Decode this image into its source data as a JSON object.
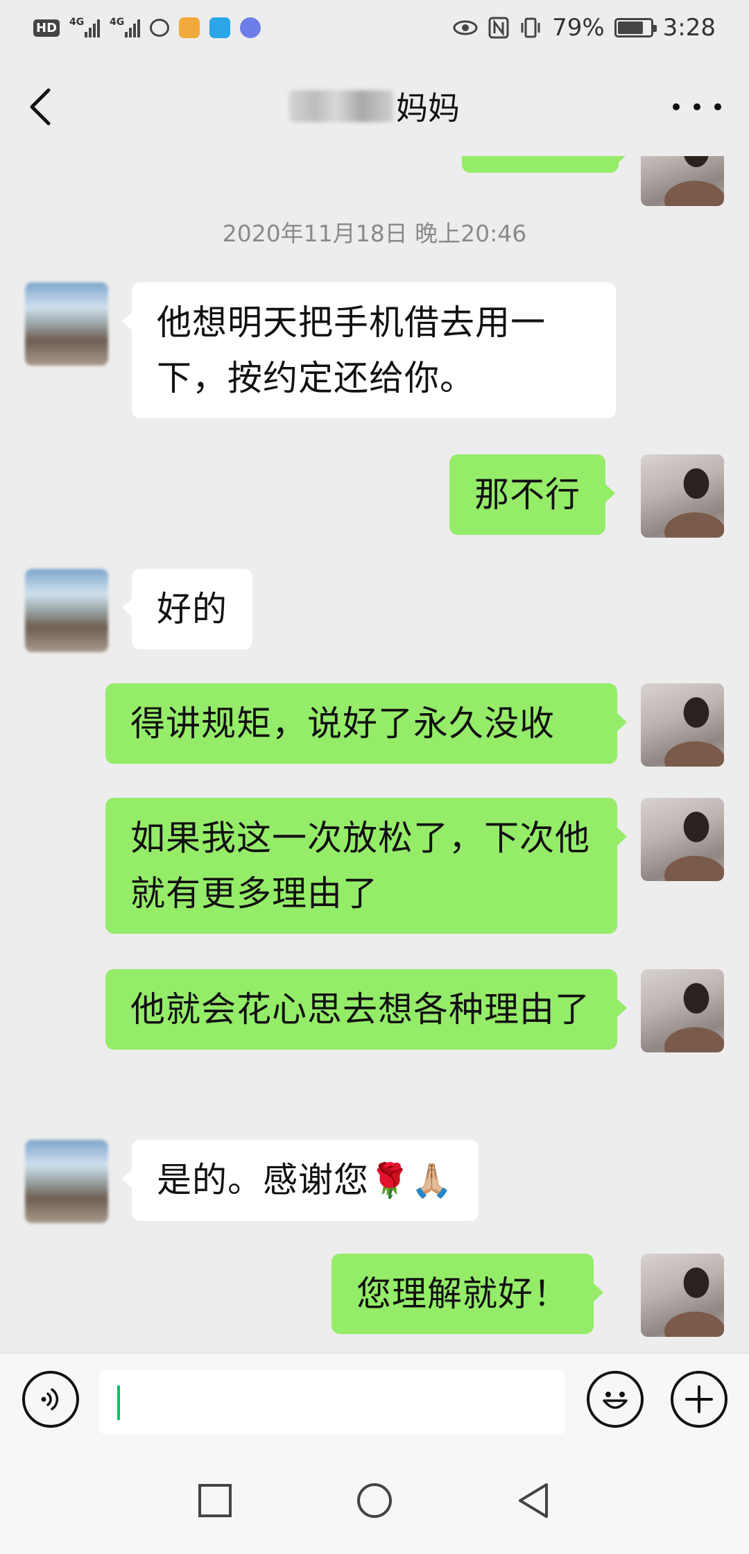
{
  "status_bar": {
    "hd_badge": "HD",
    "sim1_label": "4G",
    "sim2_label": "4G",
    "battery_text": "79%",
    "battery_level": 0.79,
    "time": "3:28"
  },
  "header": {
    "title": "妈妈"
  },
  "chat": {
    "timestamp": "2020年11月18日 晚上20:46",
    "messages": [
      {
        "side": "in",
        "text": "他想明天把手机借去用一下，按约定还给你。"
      },
      {
        "side": "out",
        "text": "那不行"
      },
      {
        "side": "in",
        "text": "好的"
      },
      {
        "side": "out",
        "text": "得讲规矩，说好了永久没收"
      },
      {
        "side": "out",
        "text": "如果我这一次放松了，下次他就有更多理由了"
      },
      {
        "side": "out",
        "text": "他就会花心思去想各种理由了"
      },
      {
        "side": "in",
        "text": "是的。感谢您",
        "emoji": "🌹🙏🏼"
      },
      {
        "side": "out",
        "text": "您理解就好！"
      }
    ]
  },
  "input": {
    "value": ""
  },
  "colors": {
    "background": "#ededed",
    "outgoing_bubble": "#95ec69",
    "incoming_bubble": "#ffffff",
    "caret": "#07c160"
  },
  "icons": [
    "back-arrow-icon",
    "more-dots-icon",
    "voice-icon",
    "emoji-icon",
    "plus-icon",
    "square-nav-icon",
    "circle-nav-icon",
    "triangle-back-nav-icon"
  ]
}
